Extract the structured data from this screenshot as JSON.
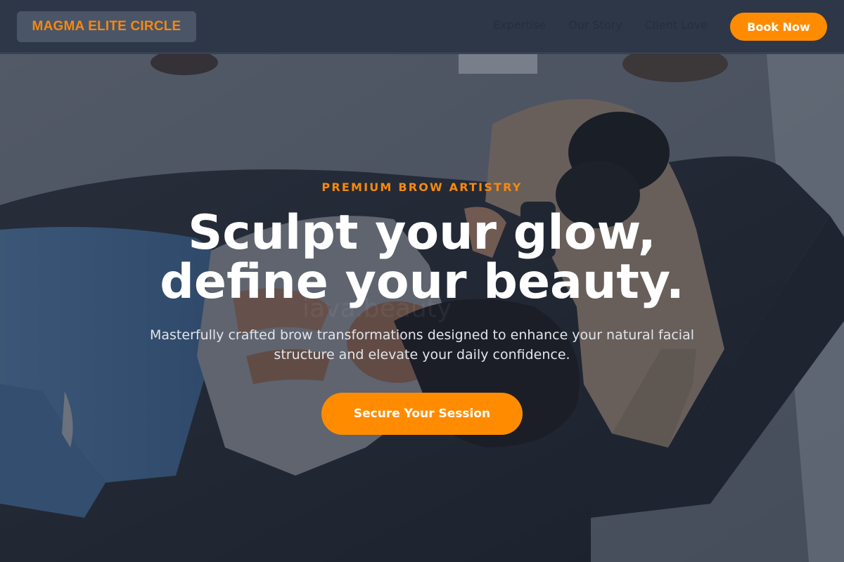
{
  "brand": {
    "name": "MAGMA ELITE CIRCLE",
    "accent_color": "#ff8c00"
  },
  "nav": {
    "links": [
      "Expertise",
      "Our Story",
      "Client Love"
    ],
    "book_label": "Book Now"
  },
  "hero": {
    "eyebrow": "PREMIUM BROW ARTISTRY",
    "headline_line1": "Sculpt your glow,",
    "headline_line2": "define your beauty.",
    "subtext": "Masterfully crafted brow transformations designed to enhance your natural facial structure and elevate your daily confidence.",
    "cta_label": "Secure Your Session",
    "watermark": "iava.beauty"
  }
}
